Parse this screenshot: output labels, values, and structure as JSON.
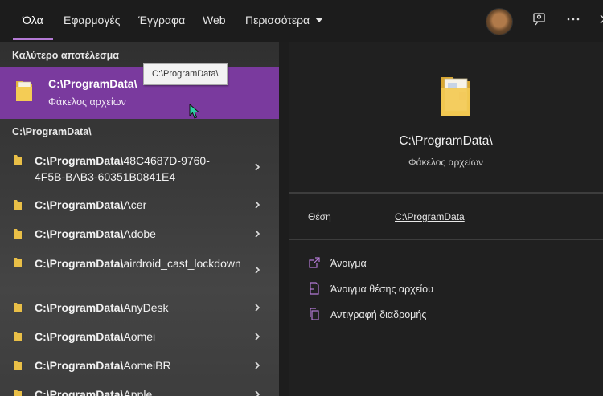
{
  "tabs": [
    {
      "label": "Όλα"
    },
    {
      "label": "Εφαρμογές"
    },
    {
      "label": "Έγγραφα"
    },
    {
      "label": "Web"
    },
    {
      "label": "Περισσότερα"
    }
  ],
  "header_icons": [
    "avatar",
    "feedback-icon",
    "more-icon",
    "close-icon"
  ],
  "best_match": {
    "section": "Καλύτερο αποτέλεσμα",
    "title": "C:\\ProgramData\\",
    "subtitle": "Φάκελος αρχείων",
    "tooltip": "C:\\ProgramData\\"
  },
  "results": {
    "section": "C:\\ProgramData\\",
    "items": [
      {
        "bold": "C:\\ProgramData\\",
        "rest": "48C4687D-9760-4F5B-BAB3-60351B0841E4"
      },
      {
        "bold": "C:\\ProgramData\\",
        "rest": "Acer"
      },
      {
        "bold": "C:\\ProgramData\\",
        "rest": "Adobe"
      },
      {
        "bold": "C:\\ProgramData\\",
        "rest": "airdroid_cast_lockdown"
      },
      {
        "bold": "C:\\ProgramData\\",
        "rest": "AnyDesk"
      },
      {
        "bold": "C:\\ProgramData\\",
        "rest": "Aomei"
      },
      {
        "bold": "C:\\ProgramData\\",
        "rest": "AomeiBR"
      },
      {
        "bold": "C:\\ProgramData\\",
        "rest": "Apple"
      }
    ]
  },
  "details": {
    "title": "C:\\ProgramData\\",
    "subtitle": "Φάκελος αρχείων",
    "location_label": "Θέση",
    "location_value": "C:\\ProgramData",
    "actions": [
      {
        "label": "Άνοιγμα",
        "icon": "open-icon"
      },
      {
        "label": "Άνοιγμα θέσης αρχείου",
        "icon": "file-location-icon"
      },
      {
        "label": "Αντιγραφή διαδρομής",
        "icon": "copy-path-icon"
      }
    ]
  },
  "colors": {
    "accent": "#b47ad5",
    "highlight": "#7a3a9e"
  }
}
